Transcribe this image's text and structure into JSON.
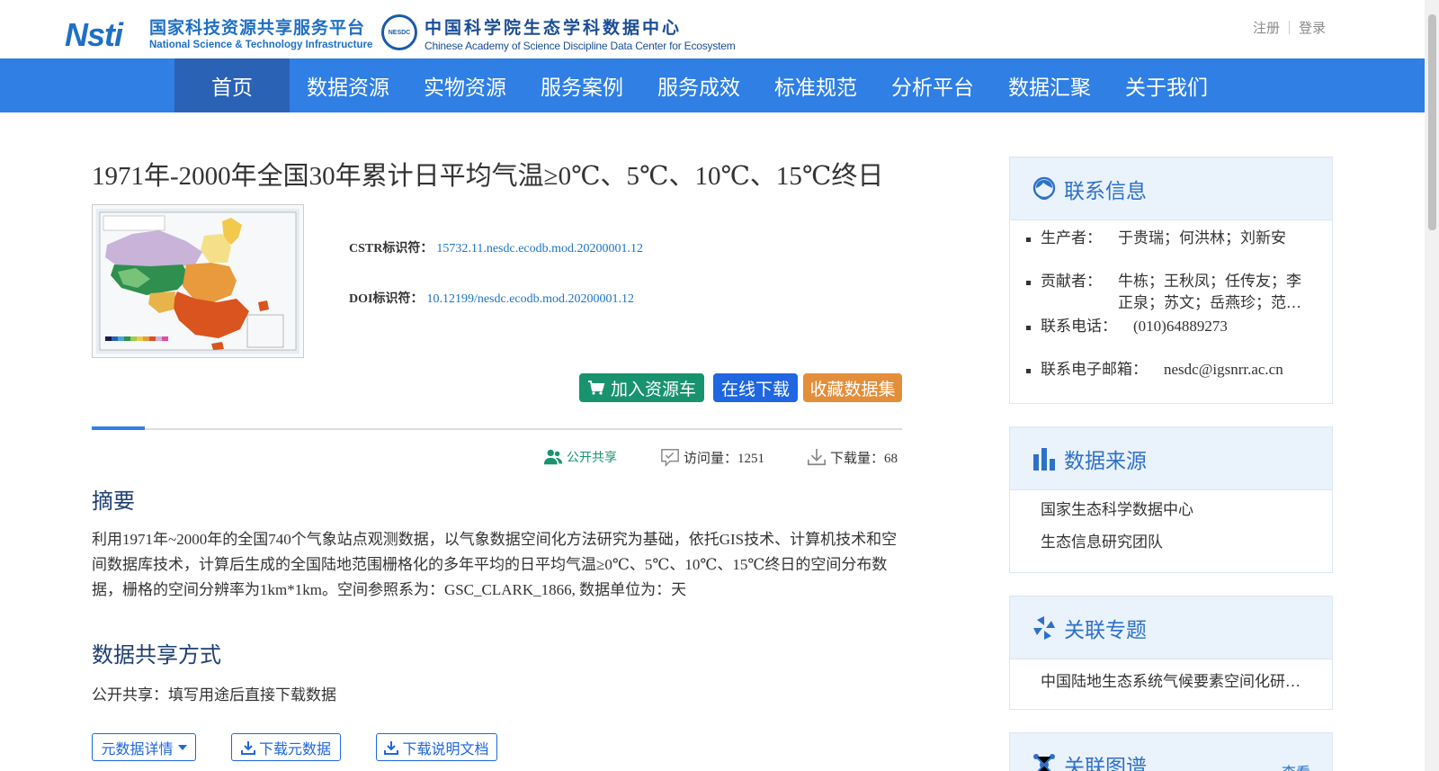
{
  "header": {
    "nsti_mark": "Nsti",
    "nsti_cn": "国家科技资源共享服务平台",
    "nsti_en": "National Science & Technology Infrastructure",
    "nesdc_mark": "NESDC",
    "nesdc_cn": "中国科学院生态学科数据中心",
    "nesdc_en": "Chinese Academy of Science Discipline Data Center for Ecosystem",
    "register": "注册",
    "login": "登录"
  },
  "nav": {
    "items": [
      "首页",
      "数据资源",
      "实物资源",
      "服务案例",
      "服务成效",
      "标准规范",
      "分析平台",
      "数据汇聚",
      "关于我们"
    ],
    "active_index": 0
  },
  "dataset": {
    "title": "1971年-2000年全国30年累计日平均气温≥0℃、5℃、10℃、15℃终日",
    "cstr_label": "CSTR标识符：",
    "cstr_value": "15732.11.nesdc.ecodb.mod.20200001.12",
    "doi_label": "DOI标识符：",
    "doi_value": "10.12199/nesdc.ecodb.mod.20200001.12",
    "btn_cart": "加入资源车",
    "btn_download": "在线下载",
    "btn_favorite": "收藏数据集",
    "share_status": "公开共享",
    "visits": "访问量：1251",
    "downloads": "下载量：68"
  },
  "abstract": {
    "heading": "摘要",
    "text": "利用1971年~2000年的全国740个气象站点观测数据，以气象数据空间化方法研究为基础，依托GIS技术、计算机技术和空间数据库技术，计算后生成的全国陆地范围栅格化的多年平均的日平均气温≥0℃、5℃、10℃、15℃终日的空间分布数据，栅格的空间分辨率为1km*1km。空间参照系为：GSC_CLARK_1866, 数据单位为：天"
  },
  "share": {
    "heading": "数据共享方式",
    "text": "公开共享：填写用途后直接下载数据",
    "btn_metadata": "元数据详情",
    "btn_download_metadata": "下载元数据",
    "btn_download_doc": "下载说明文档"
  },
  "sidebar": {
    "contact": {
      "title": "联系信息",
      "producer_label": "生产者：",
      "producer_value": "于贵瑞；何洪林；刘新安",
      "contributor_label": "贡献者：",
      "contributor_value": "牛栋；王秋凤；任传友；李正泉；苏文；岳燕珍；范…",
      "phone_label": "联系电话：",
      "phone_value": "(010)64889273",
      "email_label": "联系电子邮箱：",
      "email_value": "nesdc@igsnrr.ac.cn"
    },
    "source": {
      "title": "数据来源",
      "items": [
        "国家生态科学数据中心",
        "生态信息研究团队"
      ]
    },
    "topic": {
      "title": "关联专题",
      "items": [
        "中国陆地生态系统气候要素空间化研…"
      ]
    },
    "graph": {
      "title": "关联图谱",
      "more": "查看"
    }
  },
  "colors": {
    "nav_bg": "#2f7fe4",
    "nav_active": "#2a62b6",
    "cart_btn": "#18936e",
    "download_btn": "#1f66e0",
    "favorite_btn": "#e38e3a",
    "heading": "#1e3f75",
    "link": "#1c73c9"
  }
}
